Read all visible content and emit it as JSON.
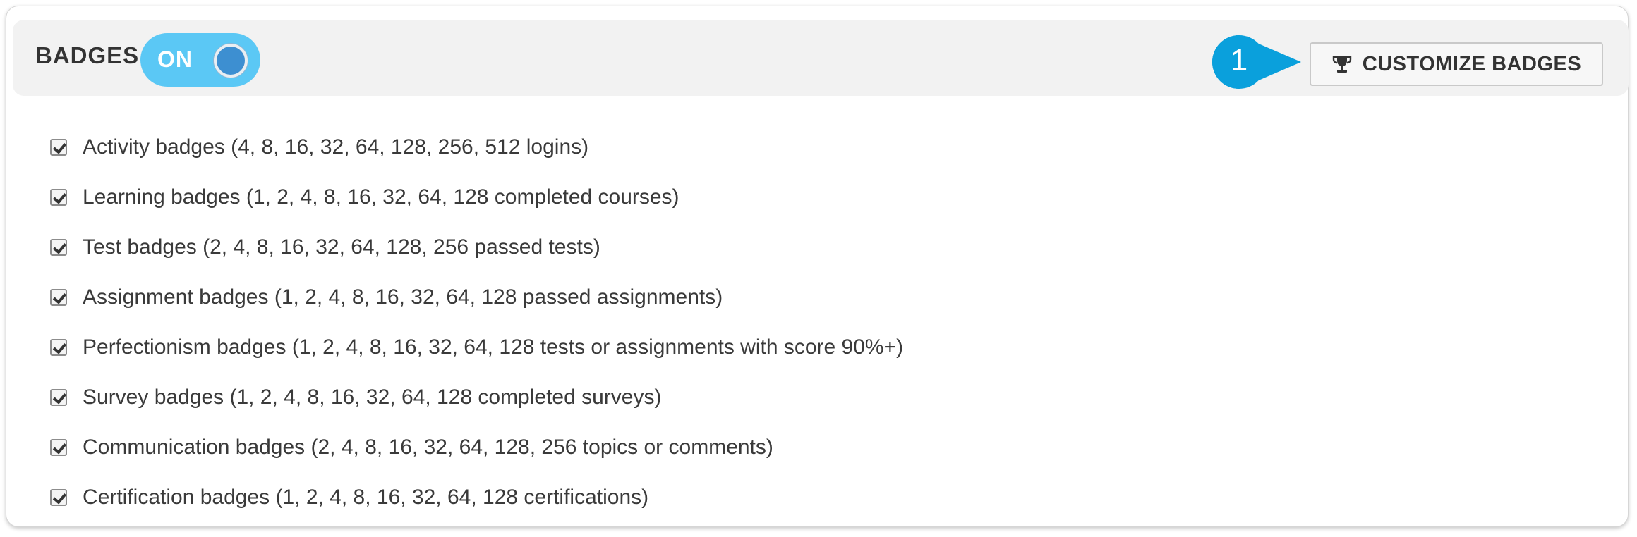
{
  "header": {
    "title": "BADGES",
    "toggle": {
      "label": "ON",
      "state": "on",
      "color": "#5bc8f5"
    },
    "callout": {
      "number": "1",
      "color": "#0aa0dc"
    },
    "customize_button": {
      "label": "CUSTOMIZE BADGES",
      "icon": "trophy-icon"
    }
  },
  "badges": [
    {
      "label": "Activity badges (4, 8, 16, 32, 64, 128, 256, 512 logins)",
      "checked": true
    },
    {
      "label": "Learning badges (1, 2, 4, 8, 16, 32, 64, 128 completed courses)",
      "checked": true
    },
    {
      "label": "Test badges (2, 4, 8, 16, 32, 64, 128, 256 passed tests)",
      "checked": true
    },
    {
      "label": "Assignment badges (1, 2, 4, 8, 16, 32, 64, 128 passed assignments)",
      "checked": true
    },
    {
      "label": "Perfectionism badges (1, 2, 4, 8, 16, 32, 64, 128 tests or assignments with score 90%+)",
      "checked": true
    },
    {
      "label": "Survey badges (1, 2, 4, 8, 16, 32, 64, 128 completed surveys)",
      "checked": true
    },
    {
      "label": "Communication badges (2, 4, 8, 16, 32, 64, 128, 256 topics or comments)",
      "checked": true
    },
    {
      "label": "Certification badges (1, 2, 4, 8, 16, 32, 64, 128 certifications)",
      "checked": true
    }
  ]
}
